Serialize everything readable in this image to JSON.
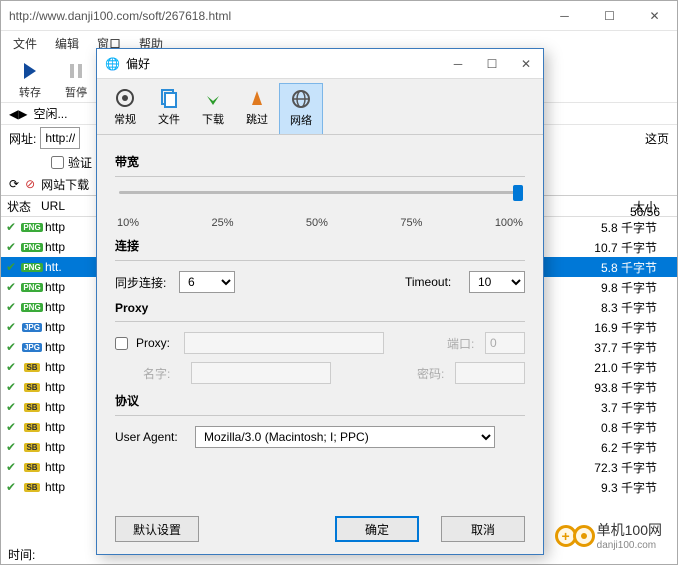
{
  "main": {
    "url": "http://www.danji100.com/soft/267618.html",
    "menu": {
      "file": "文件",
      "edit": "编辑",
      "window": "窗口",
      "help": "帮助"
    },
    "toolbar": {
      "save": "转存",
      "pause": "暂停"
    },
    "idle": "空闲...",
    "addr_label": "网址:",
    "addr_prefix": "http://",
    "verify_label": "验证",
    "download_label": "网站下载",
    "thispage": "这页",
    "counter": "56/56",
    "headers": {
      "status": "状态",
      "url": "URL",
      "size": "大小"
    },
    "footer": "时间:",
    "rows": [
      {
        "type": "png",
        "t": "http",
        "size": "5.8 千字节",
        "sel": false
      },
      {
        "type": "png",
        "t": "http",
        "size": "10.7 千字节",
        "sel": false
      },
      {
        "type": "png",
        "t": "htt.",
        "size": "5.8 千字节",
        "sel": true
      },
      {
        "type": "png",
        "t": "http",
        "size": "9.8 千字节",
        "sel": false
      },
      {
        "type": "png",
        "t": "http",
        "size": "8.3 千字节",
        "sel": false
      },
      {
        "type": "jpg",
        "t": "http",
        "size": "16.9 千字节",
        "sel": false
      },
      {
        "type": "jpg",
        "t": "http",
        "size": "37.7 千字节",
        "sel": false
      },
      {
        "type": "sb",
        "t": "http",
        "size": "21.0 千字节",
        "sel": false
      },
      {
        "type": "sb",
        "t": "http",
        "size": "93.8 千字节",
        "sel": false
      },
      {
        "type": "sb",
        "t": "http",
        "size": "3.7 千字节",
        "sel": false
      },
      {
        "type": "sb",
        "t": "http",
        "size": "0.8 千字节",
        "sel": false
      },
      {
        "type": "sb",
        "t": "http",
        "size": "6.2 千字节",
        "sel": false
      },
      {
        "type": "sb",
        "t": "http",
        "size": "72.3 千字节",
        "sel": false
      },
      {
        "type": "sb",
        "t": "http",
        "size": "9.3 千字节",
        "sel": false
      }
    ]
  },
  "dialog": {
    "title": "偏好",
    "tabs": {
      "general": "常规",
      "files": "文件",
      "download": "下载",
      "skip": "跳过",
      "network": "网络"
    },
    "bandwidth": {
      "title": "带宽",
      "labels": [
        "10%",
        "25%",
        "50%",
        "75%",
        "100%"
      ],
      "value_pct": 100
    },
    "connection": {
      "title": "连接",
      "sync_label": "同步连接:",
      "sync_value": "6",
      "timeout_label": "Timeout:",
      "timeout_value": "10"
    },
    "proxy": {
      "title": "Proxy",
      "checkbox_label": "Proxy:",
      "host": "",
      "port_label": "端口:",
      "port": "0",
      "user_label": "名字:",
      "user": "",
      "pass_label": "密码:",
      "pass": ""
    },
    "protocol": {
      "title": "协议",
      "ua_label": "User Agent:",
      "ua_value": "Mozilla/3.0 (Macintosh; I; PPC)"
    },
    "buttons": {
      "defaults": "默认设置",
      "ok": "确定",
      "cancel": "取消"
    }
  },
  "watermark": {
    "name": "单机100网",
    "domain": "danji100.com"
  }
}
